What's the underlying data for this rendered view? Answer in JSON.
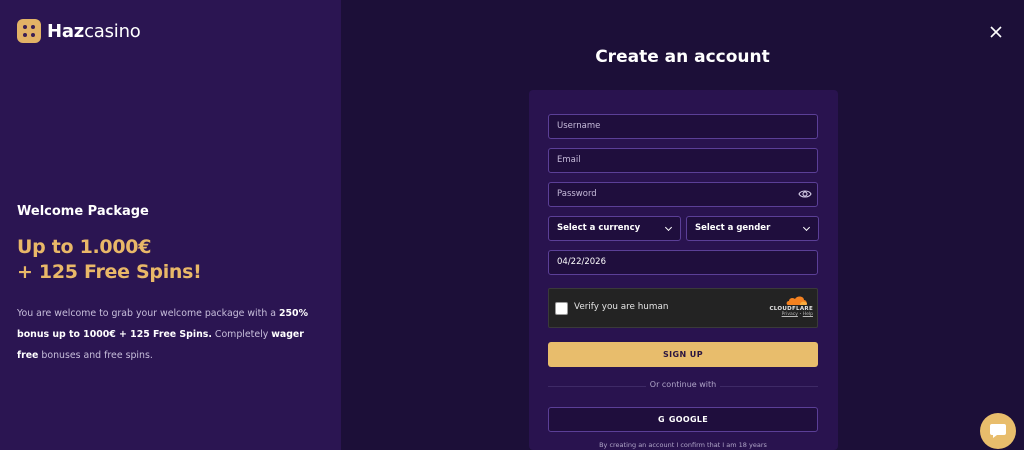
{
  "brand": {
    "name_bold": "Haz",
    "name_regular": "casino",
    "logo_color": "#e2b266"
  },
  "promo": {
    "title": "Welcome Package",
    "headline_line1": "Up to 1.000€",
    "headline_line2": "+ 125 Free Spins!",
    "desc_part1": "You are welcome to grab your welcome package with a ",
    "desc_bold1": "250% bonus up to 1000€ + 125 Free Spins.",
    "desc_part2": " Completely ",
    "desc_bold2": "wager free",
    "desc_part3": " bonuses and free spins."
  },
  "form": {
    "title": "Create an account",
    "username_placeholder": "Username",
    "email_placeholder": "Email",
    "password_placeholder": "Password",
    "currency_label": "Select a currency",
    "gender_label": "Select a gender",
    "date_value": "04/22/2026",
    "captcha_label": "Verify you are human",
    "captcha_brand": "CLOUDFLARE",
    "captcha_privacy": "Privacy",
    "captcha_sep": " · ",
    "captcha_help": "Help",
    "signup_label": "SIGN UP",
    "or_continue": "Or continue with",
    "google_label": "GOOGLE",
    "terms": "By creating an account I confirm that I am 18 years"
  },
  "colors": {
    "accent": "#e8bd6c",
    "promo": "#e9b868",
    "left_bg": "#2b1552",
    "right_bg": "#1c0f38"
  },
  "icons": {
    "close": "close-icon",
    "eye": "eye-icon",
    "chevron": "chevron-down-icon",
    "chat": "chat-icon",
    "google": "google-icon",
    "cloudflare": "cloudflare-icon"
  }
}
